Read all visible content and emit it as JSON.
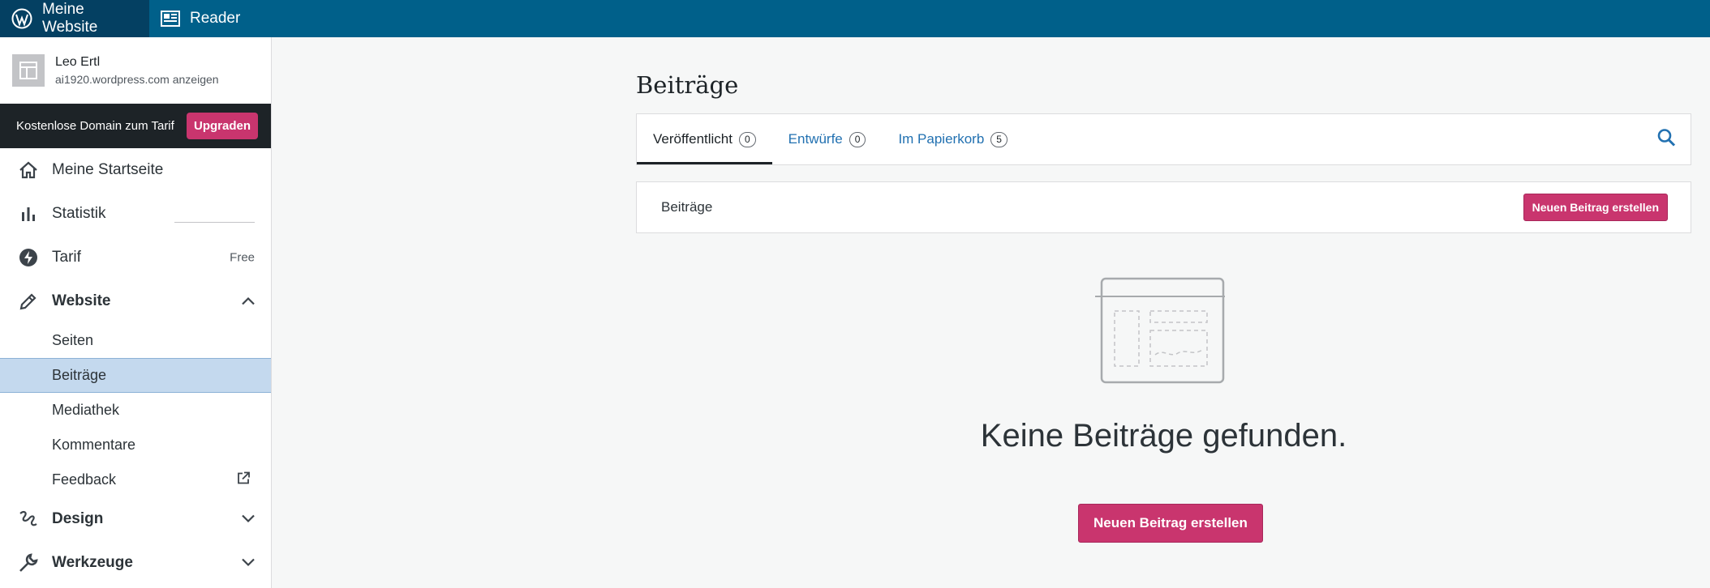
{
  "topbar": {
    "site_label": "Meine Website",
    "reader_label": "Reader"
  },
  "sidebar": {
    "site": {
      "name": "Leo Ertl",
      "url_text": "ai1920.wordpress.com anzeigen"
    },
    "promo": {
      "text": "Kostenlose Domain zum Tarif",
      "button": "Upgraden"
    },
    "items": [
      {
        "label": "Meine Startseite",
        "icon": "home-icon"
      },
      {
        "label": "Statistik",
        "icon": "bar-chart-icon"
      },
      {
        "label": "Tarif",
        "icon": "plan-icon",
        "badge": "Free"
      },
      {
        "label": "Website",
        "icon": "pencil-icon"
      }
    ],
    "website_sub": [
      "Seiten",
      "Beiträge",
      "Mediathek",
      "Kommentare",
      "Feedback"
    ],
    "bottom_items": [
      {
        "label": "Design",
        "icon": "brush-icon"
      },
      {
        "label": "Werkzeuge",
        "icon": "wrench-icon"
      }
    ]
  },
  "main": {
    "title": "Beiträge",
    "tabs": [
      {
        "label": "Veröffentlicht",
        "count": "0"
      },
      {
        "label": "Entwürfe",
        "count": "0"
      },
      {
        "label": "Im Papierkorb",
        "count": "5"
      }
    ],
    "section_label": "Beiträge",
    "new_post_small": "Neuen Beitrag erstellen",
    "empty_message": "Keine Beiträge gefunden.",
    "new_post_large": "Neuen Beitrag erstellen"
  },
  "colors": {
    "topbar": "#00608a",
    "accent": "#c9356e",
    "link": "#2271b1",
    "selected_bg": "#c4d9ee"
  }
}
